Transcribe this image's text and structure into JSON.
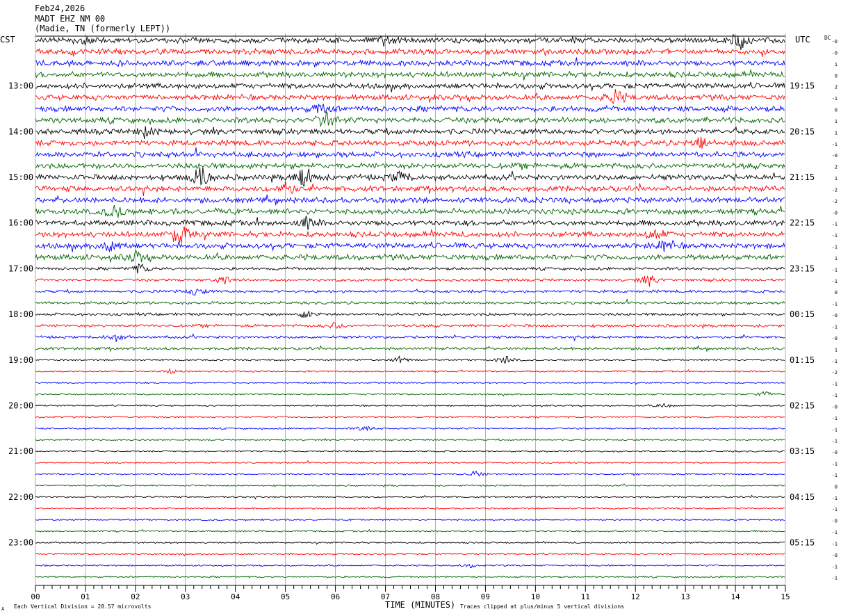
{
  "header": {
    "date": "Feb24,2026",
    "station": "MADT EHZ NM 00",
    "location": "(Madie, TN (formerly LEPT))"
  },
  "chart_data": {
    "type": "line",
    "title": "",
    "left_timezone": "CST",
    "right_timezone": "UTC",
    "xlabel": "TIME (MINUTES)",
    "x_ticks": [
      "00",
      "01",
      "02",
      "03",
      "04",
      "05",
      "06",
      "07",
      "08",
      "09",
      "10",
      "11",
      "12",
      "13",
      "14",
      "15"
    ],
    "xlim": [
      0,
      15
    ],
    "left_hour_labels": [
      "13:00",
      "14:00",
      "15:00",
      "16:00",
      "17:00",
      "18:00",
      "19:00",
      "20:00",
      "21:00",
      "22:00",
      "23:00"
    ],
    "right_hour_labels": [
      "19:15",
      "20:15",
      "21:15",
      "22:15",
      "23:15",
      "00:15",
      "01:15",
      "02:15",
      "03:15",
      "04:15",
      "05:15"
    ],
    "trace_count": 48,
    "trace_colors": [
      "#000000",
      "#ff0000",
      "#0000ff",
      "#006400"
    ],
    "dc_header": "DC",
    "dc_offsets": [
      "-0",
      "-0",
      "1",
      "0",
      "2",
      "-1",
      "0",
      "1",
      "1",
      "-1",
      "-0",
      "2",
      "1",
      "-2",
      "-2",
      "-0",
      "-1",
      "-1",
      "-1",
      "1",
      "-1",
      "-1",
      "0",
      "-1",
      "-0",
      "-1",
      "-0",
      "1",
      "-1",
      "-2",
      "-1",
      "-1",
      "-0",
      "-1",
      "-1",
      "-1",
      "-0",
      "-1",
      "-1",
      "0",
      "-1",
      "-1",
      "-0",
      "-1",
      "-1",
      "-0",
      "-1",
      "-1"
    ],
    "footer_left": "Each Vertical Division =   28.57 microvolts",
    "footer_right": "Traces clipped at plus/minus 5 vertical divisions",
    "bursts": [
      {
        "trace": 0,
        "minute": 14.1,
        "amp": 2.2
      },
      {
        "trace": 0,
        "minute": 7.0,
        "amp": 1.2
      },
      {
        "trace": 0,
        "minute": 1.0,
        "amp": 1.0
      },
      {
        "trace": 5,
        "minute": 11.6,
        "amp": 2.0
      },
      {
        "trace": 6,
        "minute": 5.7,
        "amp": 1.6
      },
      {
        "trace": 7,
        "minute": 5.8,
        "amp": 2.2
      },
      {
        "trace": 8,
        "minute": 2.2,
        "amp": 1.5
      },
      {
        "trace": 9,
        "minute": 13.3,
        "amp": 1.8
      },
      {
        "trace": 12,
        "minute": 3.3,
        "amp": 3.2
      },
      {
        "trace": 12,
        "minute": 5.4,
        "amp": 3.2
      },
      {
        "trace": 12,
        "minute": 7.3,
        "amp": 1.5
      },
      {
        "trace": 13,
        "minute": 5.0,
        "amp": 2.0
      },
      {
        "trace": 15,
        "minute": 1.6,
        "amp": 1.8
      },
      {
        "trace": 16,
        "minute": 5.4,
        "amp": 1.6
      },
      {
        "trace": 17,
        "minute": 2.9,
        "amp": 3.5
      },
      {
        "trace": 17,
        "minute": 12.4,
        "amp": 1.5
      },
      {
        "trace": 18,
        "minute": 1.5,
        "amp": 2.0
      },
      {
        "trace": 18,
        "minute": 12.6,
        "amp": 1.8
      },
      {
        "trace": 19,
        "minute": 2.0,
        "amp": 1.5
      },
      {
        "trace": 20,
        "minute": 2.1,
        "amp": 1.4
      },
      {
        "trace": 21,
        "minute": 12.3,
        "amp": 1.6
      },
      {
        "trace": 21,
        "minute": 3.8,
        "amp": 1.2
      },
      {
        "trace": 22,
        "minute": 3.2,
        "amp": 1.0
      },
      {
        "trace": 24,
        "minute": 5.4,
        "amp": 1.0
      },
      {
        "trace": 25,
        "minute": 6.0,
        "amp": 0.9
      },
      {
        "trace": 26,
        "minute": 1.6,
        "amp": 1.0
      },
      {
        "trace": 28,
        "minute": 9.4,
        "amp": 1.2
      },
      {
        "trace": 28,
        "minute": 7.3,
        "amp": 0.9
      },
      {
        "trace": 29,
        "minute": 2.7,
        "amp": 0.6
      },
      {
        "trace": 31,
        "minute": 14.6,
        "amp": 0.7
      },
      {
        "trace": 32,
        "minute": 12.6,
        "amp": 0.6
      },
      {
        "trace": 34,
        "minute": 6.6,
        "amp": 0.8
      },
      {
        "trace": 38,
        "minute": 8.8,
        "amp": 0.8
      },
      {
        "trace": 46,
        "minute": 8.7,
        "amp": 0.5
      }
    ]
  }
}
